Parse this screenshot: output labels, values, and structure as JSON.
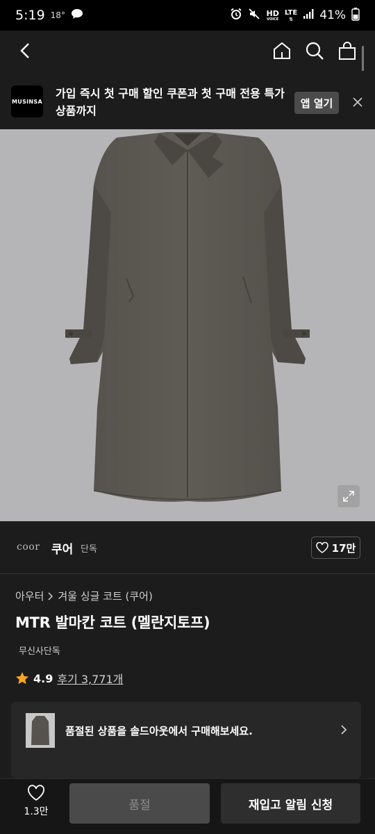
{
  "status_bar": {
    "time": "5:19",
    "temperature": "18°",
    "network_hd": "HD",
    "network_voice": "VOICE",
    "network_lte": "LTE",
    "battery": "41%"
  },
  "banner": {
    "logo_text": "MUSINSA",
    "message": "가입 즉시 첫 구매 할인 쿠폰과 첫 구매 전용 특가 상품까지",
    "open_app_label": "앱 열기"
  },
  "brand": {
    "logo_text": "coor",
    "name": "쿠어",
    "tag": "단독",
    "like_count": "17만"
  },
  "breadcrumb": {
    "category": "아우터",
    "subcategory": "겨울 싱글 코트 (쿠어)"
  },
  "product": {
    "title": "MTR 발마칸 코트 (멜란지토프)",
    "exclusive_label": "무신사단독",
    "rating": "4.9",
    "reviews": "후기 3,771개"
  },
  "soldout_card": {
    "message": "품절된 상품을 솔드아웃에서 구매해보세요."
  },
  "bottom_bar": {
    "wish_count": "1.3만",
    "soldout_label": "품절",
    "restock_label": "재입고 알림 신청"
  },
  "colors": {
    "background": "#1c1c1c",
    "image_bg": "#b5b5b7",
    "coat": "#5b5852",
    "star": "#f5a623"
  }
}
